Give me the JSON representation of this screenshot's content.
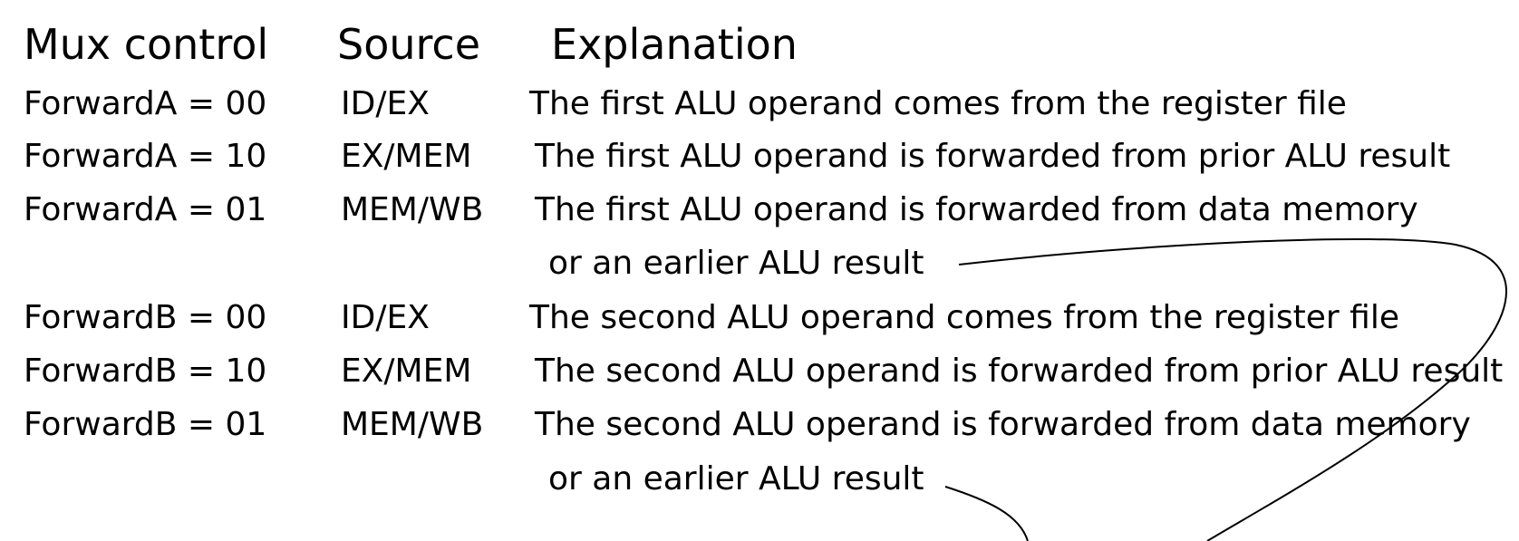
{
  "headers": {
    "mux_control": "Mux control",
    "source": "Source",
    "explanation": "Explanation"
  },
  "rows": [
    {
      "mux": "ForwardA = 00",
      "source": "ID/EX",
      "explanation": "The first ALU operand comes from the register file"
    },
    {
      "mux": "ForwardA = 10",
      "source": "EX/MEM",
      "explanation": "The first ALU operand is forwarded from prior ALU result"
    },
    {
      "mux": "ForwardA = 01",
      "source": "MEM/WB",
      "explanation": "The first ALU operand is forwarded from data memory",
      "continuation": "or an earlier ALU result"
    },
    {
      "mux": "ForwardB = 00",
      "source": "ID/EX",
      "explanation": "The second ALU operand comes from the register file"
    },
    {
      "mux": "ForwardB = 10",
      "source": "EX/MEM",
      "explanation": "The second ALU operand is forwarded from prior ALU result"
    },
    {
      "mux": "ForwardB = 01",
      "source": "MEM/WB",
      "explanation": "The second ALU operand is forwarded from data memory",
      "continuation": "or an earlier ALU result"
    }
  ]
}
